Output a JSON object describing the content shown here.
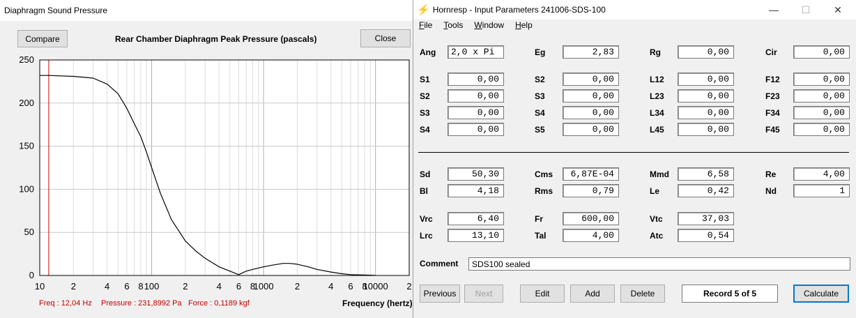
{
  "left": {
    "title": "Diaphragm Sound Pressure",
    "compare_label": "Compare",
    "close_label": "Close",
    "status": {
      "freq": "Freq : 12,04 Hz",
      "pressure": "Pressure : 231,8992 Pa",
      "force": "Force : 0,1189 kgf"
    }
  },
  "right": {
    "title": "Hornresp - Input Parameters   241006-SDS-100",
    "menu": [
      "File",
      "Tools",
      "Window",
      "Help"
    ],
    "window_controls": {
      "minimize": "—",
      "maximize": "☐",
      "close": "✕"
    },
    "fields": [
      {
        "label": "Ang",
        "value": "2,0 x Pi",
        "col": 0,
        "row": "a"
      },
      {
        "label": "Eg",
        "value": "2,83",
        "col": 1,
        "row": "a"
      },
      {
        "label": "Rg",
        "value": "0,00",
        "col": 2,
        "row": "a"
      },
      {
        "label": "Cir",
        "value": "0,00",
        "col": 3,
        "row": "a"
      },
      {
        "label": "S1",
        "value": "0,00",
        "col": 0,
        "row": "b"
      },
      {
        "label": "S2",
        "value": "0,00",
        "col": 1,
        "row": "b"
      },
      {
        "label": "L12",
        "value": "0,00",
        "col": 2,
        "row": "b"
      },
      {
        "label": "F12",
        "value": "0,00",
        "col": 3,
        "row": "b"
      },
      {
        "label": "S2",
        "value": "0,00",
        "col": 0,
        "row": "c"
      },
      {
        "label": "S3",
        "value": "0,00",
        "col": 1,
        "row": "c"
      },
      {
        "label": "L23",
        "value": "0,00",
        "col": 2,
        "row": "c"
      },
      {
        "label": "F23",
        "value": "0,00",
        "col": 3,
        "row": "c"
      },
      {
        "label": "S3",
        "value": "0,00",
        "col": 0,
        "row": "d"
      },
      {
        "label": "S4",
        "value": "0,00",
        "col": 1,
        "row": "d"
      },
      {
        "label": "L34",
        "value": "0,00",
        "col": 2,
        "row": "d"
      },
      {
        "label": "F34",
        "value": "0,00",
        "col": 3,
        "row": "d"
      },
      {
        "label": "S4",
        "value": "0,00",
        "col": 0,
        "row": "e"
      },
      {
        "label": "S5",
        "value": "0,00",
        "col": 1,
        "row": "e"
      },
      {
        "label": "L45",
        "value": "0,00",
        "col": 2,
        "row": "e"
      },
      {
        "label": "F45",
        "value": "0,00",
        "col": 3,
        "row": "e"
      },
      {
        "label": "Sd",
        "value": "50,30",
        "col": 0,
        "row": "f"
      },
      {
        "label": "Cms",
        "value": "6,87E-04",
        "col": 1,
        "row": "f"
      },
      {
        "label": "Mmd",
        "value": "6,58",
        "col": 2,
        "row": "f"
      },
      {
        "label": "Re",
        "value": "4,00",
        "col": 3,
        "row": "f"
      },
      {
        "label": "Bl",
        "value": "4,18",
        "col": 0,
        "row": "g"
      },
      {
        "label": "Rms",
        "value": "0,79",
        "col": 1,
        "row": "g"
      },
      {
        "label": "Le",
        "value": "0,42",
        "col": 2,
        "row": "g"
      },
      {
        "label": "Nd",
        "value": "1",
        "col": 3,
        "row": "g"
      },
      {
        "label": "Vrc",
        "value": "6,40",
        "col": 0,
        "row": "h"
      },
      {
        "label": "Fr",
        "value": "600,00",
        "col": 1,
        "row": "h"
      },
      {
        "label": "Vtc",
        "value": "37,03",
        "col": 2,
        "row": "h"
      },
      {
        "label": "Lrc",
        "value": "13,10",
        "col": 0,
        "row": "i"
      },
      {
        "label": "Tal",
        "value": "4,00",
        "col": 1,
        "row": "i"
      },
      {
        "label": "Atc",
        "value": "0,54",
        "col": 2,
        "row": "i"
      }
    ],
    "comment_label": "Comment",
    "comment_value": "SDS100 sealed",
    "buttons": {
      "previous": "Previous",
      "next": "Next",
      "edit": "Edit",
      "add": "Add",
      "delete": "Delete",
      "calculate": "Calculate"
    },
    "record": "Record 5 of 5"
  },
  "chart_data": {
    "type": "line",
    "title": "Rear Chamber Diaphragm Peak Pressure (pascals)",
    "xlabel": "Frequency (hertz)",
    "ylabel": "",
    "xscale": "log",
    "xlim": [
      10,
      20000
    ],
    "ylim": [
      0,
      250
    ],
    "yticks": [
      "0",
      "50",
      "100",
      "150",
      "200",
      "250"
    ],
    "xticks": [
      {
        "v": 10,
        "t": "10"
      },
      {
        "v": 20,
        "t": "2"
      },
      {
        "v": 40,
        "t": "4"
      },
      {
        "v": 60,
        "t": "6"
      },
      {
        "v": 80,
        "t": "8"
      },
      {
        "v": 100,
        "t": "100"
      },
      {
        "v": 200,
        "t": "2"
      },
      {
        "v": 400,
        "t": "4"
      },
      {
        "v": 600,
        "t": "6"
      },
      {
        "v": 800,
        "t": "8"
      },
      {
        "v": 1000,
        "t": "1000"
      },
      {
        "v": 2000,
        "t": "2"
      },
      {
        "v": 4000,
        "t": "4"
      },
      {
        "v": 6000,
        "t": "6"
      },
      {
        "v": 8000,
        "t": "8"
      },
      {
        "v": 10000,
        "t": "10000"
      },
      {
        "v": 20000,
        "t": "2"
      }
    ],
    "cursor_x": 12.04,
    "colors": {
      "line": "#000000",
      "cursor": "#cc0000",
      "grid": "#c8c8c8"
    },
    "series": [
      {
        "x": [
          10,
          12.04,
          20,
          30,
          40,
          50,
          60,
          70,
          80,
          90,
          100,
          120,
          150,
          200,
          250,
          300,
          400,
          500,
          600,
          700,
          800,
          1000,
          1200,
          1500,
          1700,
          2000,
          2500,
          3000,
          4000,
          5000,
          6000,
          8000,
          10000
        ],
        "y": [
          232,
          232,
          231,
          229,
          222,
          211,
          194,
          176,
          161,
          143,
          125,
          95,
          65,
          40,
          28,
          20,
          10,
          5,
          1,
          5,
          7,
          10,
          12,
          14,
          14,
          13,
          10,
          7,
          4,
          2,
          1,
          0.5,
          0.2
        ]
      }
    ]
  }
}
